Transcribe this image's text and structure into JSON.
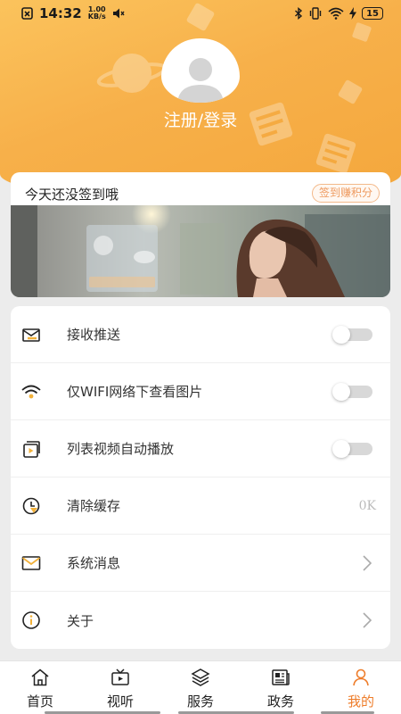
{
  "status_bar": {
    "time": "14:32",
    "net_speed_value": "1.00",
    "net_speed_unit": "KB/s",
    "battery": "15"
  },
  "profile": {
    "login_label": "注册/登录"
  },
  "sign_in": {
    "prompt": "今天还没签到哦",
    "button_label": "签到赚积分"
  },
  "settings": {
    "items": [
      {
        "label": "接收推送",
        "icon": "push-icon",
        "control": "toggle",
        "on": false
      },
      {
        "label": "仅WIFI网络下查看图片",
        "icon": "wifi-icon",
        "control": "toggle",
        "on": false
      },
      {
        "label": "列表视频自动播放",
        "icon": "video-autoplay-icon",
        "control": "toggle",
        "on": false
      },
      {
        "label": "清除缓存",
        "icon": "clear-cache-icon",
        "control": "value",
        "value": "0K"
      },
      {
        "label": "系统消息",
        "icon": "mail-icon",
        "control": "chevron"
      },
      {
        "label": "关于",
        "icon": "info-icon",
        "control": "chevron"
      }
    ]
  },
  "tab_bar": {
    "tabs": [
      {
        "label": "首页",
        "icon": "home-icon",
        "active": false
      },
      {
        "label": "视听",
        "icon": "tv-icon",
        "active": false
      },
      {
        "label": "服务",
        "icon": "layers-icon",
        "active": false
      },
      {
        "label": "政务",
        "icon": "newspaper-icon",
        "active": false
      },
      {
        "label": "我的",
        "icon": "person-icon",
        "active": true
      }
    ]
  },
  "colors": {
    "header_gradient_start": "#fbc35c",
    "header_gradient_end": "#f4a73c",
    "accent": "#ee7d2b",
    "sign_button": "#ee9a5f"
  }
}
